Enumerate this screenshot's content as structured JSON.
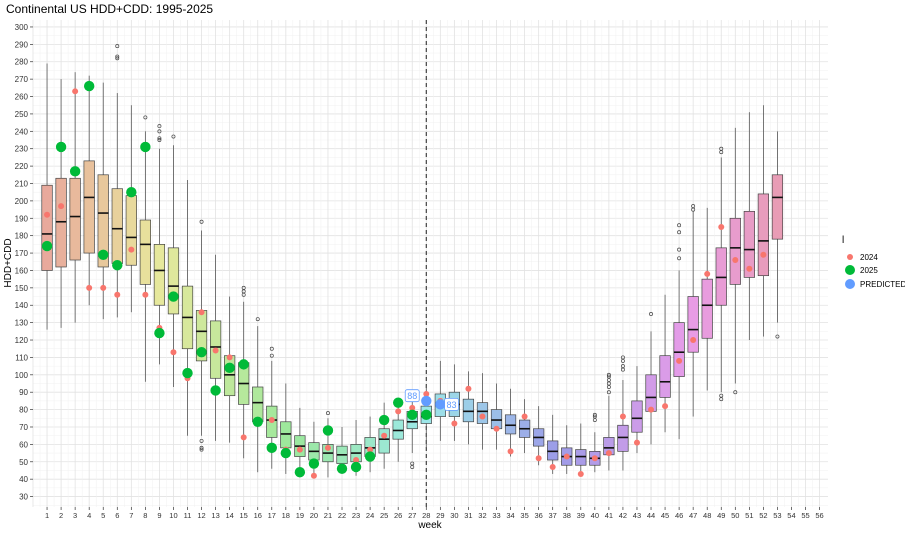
{
  "chart_data": {
    "type": "box",
    "title": "Continental US HDD+CDD: 1995-2025",
    "xlabel": "week",
    "ylabel": "HDD+CDD",
    "x_ticks": [
      "1",
      "2",
      "3",
      "4",
      "5",
      "6",
      "7",
      "8",
      "9",
      "10",
      "11",
      "12",
      "13",
      "14",
      "15",
      "16",
      "17",
      "18",
      "19",
      "20",
      "21",
      "22",
      "23",
      "24",
      "25",
      "26",
      "27",
      "28",
      "29",
      "30",
      "31",
      "32",
      "33",
      "34",
      "35",
      "36",
      "37",
      "38",
      "39",
      "40",
      "41",
      "42",
      "43",
      "44",
      "45",
      "46",
      "47",
      "48",
      "49",
      "50",
      "51",
      "52",
      "53",
      "54",
      "55",
      "56"
    ],
    "xlim": [
      0,
      56.6
    ],
    "ylim": [
      24,
      304
    ],
    "y_ticks": [
      30,
      40,
      50,
      60,
      70,
      80,
      90,
      100,
      110,
      120,
      130,
      140,
      150,
      160,
      170,
      180,
      190,
      200,
      210,
      220,
      230,
      240,
      250,
      260,
      270,
      280,
      290,
      300
    ],
    "grid": true,
    "vline_x": 28,
    "legend": {
      "title": "l",
      "position": "right",
      "items": [
        {
          "label": "2024",
          "color": "#F8766D"
        },
        {
          "label": "2025",
          "color": "#00BA38"
        },
        {
          "label": "PREDICTED",
          "color": "#619CFF"
        }
      ]
    },
    "boxes": [
      {
        "week": 1,
        "min": 126,
        "q1": 160,
        "median": 181,
        "q3": 209,
        "max": 279,
        "outliers": []
      },
      {
        "week": 2,
        "min": 127,
        "q1": 162,
        "median": 188,
        "q3": 213,
        "max": 270,
        "outliers": []
      },
      {
        "week": 3,
        "min": 130,
        "q1": 166,
        "median": 191,
        "q3": 213,
        "max": 274,
        "outliers": []
      },
      {
        "week": 4,
        "min": 140,
        "q1": 170,
        "median": 202,
        "q3": 223,
        "max": 272,
        "outliers": []
      },
      {
        "week": 5,
        "min": 132,
        "q1": 162,
        "median": 193,
        "q3": 215,
        "max": 268,
        "outliers": []
      },
      {
        "week": 6,
        "min": 133,
        "q1": 164,
        "median": 184,
        "q3": 207,
        "max": 262,
        "outliers": [
          282,
          283,
          289
        ]
      },
      {
        "week": 7,
        "min": 136,
        "q1": 163,
        "median": 179,
        "q3": 203,
        "max": 255,
        "outliers": []
      },
      {
        "week": 8,
        "min": 96,
        "q1": 152,
        "median": 175,
        "q3": 189,
        "max": 240,
        "outliers": [
          248
        ]
      },
      {
        "week": 9,
        "min": 106,
        "q1": 140,
        "median": 160,
        "q3": 175,
        "max": 230,
        "outliers": [
          235,
          236,
          240,
          243
        ]
      },
      {
        "week": 10,
        "min": 93,
        "q1": 135,
        "median": 151,
        "q3": 173,
        "max": 232,
        "outliers": [
          237
        ]
      },
      {
        "week": 11,
        "min": 65,
        "q1": 115,
        "median": 133,
        "q3": 151,
        "max": 212,
        "outliers": []
      },
      {
        "week": 12,
        "min": 65,
        "q1": 108,
        "median": 125,
        "q3": 137,
        "max": 183,
        "outliers": [
          188,
          62,
          58,
          57
        ]
      },
      {
        "week": 13,
        "min": 62,
        "q1": 98,
        "median": 116,
        "q3": 131,
        "max": 169,
        "outliers": []
      },
      {
        "week": 14,
        "min": 61,
        "q1": 88,
        "median": 100,
        "q3": 111,
        "max": 145,
        "outliers": []
      },
      {
        "week": 15,
        "min": 52,
        "q1": 83,
        "median": 95,
        "q3": 107,
        "max": 142,
        "outliers": [
          146,
          148,
          150
        ]
      },
      {
        "week": 16,
        "min": 44,
        "q1": 73,
        "median": 84,
        "q3": 93,
        "max": 128,
        "outliers": [
          132
        ]
      },
      {
        "week": 17,
        "min": 46,
        "q1": 64,
        "median": 74,
        "q3": 82,
        "max": 108,
        "outliers": [
          111,
          115
        ]
      },
      {
        "week": 18,
        "min": 43,
        "q1": 58,
        "median": 66,
        "q3": 73,
        "max": 95,
        "outliers": []
      },
      {
        "week": 19,
        "min": 41,
        "q1": 53,
        "median": 59,
        "q3": 65,
        "max": 81,
        "outliers": []
      },
      {
        "week": 20,
        "min": 41,
        "q1": 51,
        "median": 56,
        "q3": 61,
        "max": 73,
        "outliers": []
      },
      {
        "week": 21,
        "min": 41,
        "q1": 50,
        "median": 55,
        "q3": 60,
        "max": 75,
        "outliers": [
          78
        ]
      },
      {
        "week": 22,
        "min": 43,
        "q1": 49,
        "median": 54,
        "q3": 59,
        "max": 70,
        "outliers": []
      },
      {
        "week": 23,
        "min": 42,
        "q1": 50,
        "median": 55,
        "q3": 60,
        "max": 74,
        "outliers": []
      },
      {
        "week": 24,
        "min": 44,
        "q1": 53,
        "median": 58,
        "q3": 64,
        "max": 76,
        "outliers": []
      },
      {
        "week": 25,
        "min": 46,
        "q1": 55,
        "median": 63,
        "q3": 69,
        "max": 84,
        "outliers": []
      },
      {
        "week": 26,
        "min": 50,
        "q1": 63,
        "median": 68,
        "q3": 74,
        "max": 86,
        "outliers": []
      },
      {
        "week": 27,
        "min": 55,
        "q1": 69,
        "median": 73,
        "q3": 79,
        "max": 91,
        "outliers": [
          47,
          49
        ]
      },
      {
        "week": 28,
        "min": 58,
        "q1": 72,
        "median": 76,
        "q3": 82,
        "max": 94,
        "outliers": []
      },
      {
        "week": 29,
        "min": 62,
        "q1": 76,
        "median": 83,
        "q3": 89,
        "max": 108,
        "outliers": []
      },
      {
        "week": 30,
        "min": 62,
        "q1": 76,
        "median": 83,
        "q3": 90,
        "max": 106,
        "outliers": []
      },
      {
        "week": 31,
        "min": 60,
        "q1": 73,
        "median": 79,
        "q3": 86,
        "max": 102,
        "outliers": []
      },
      {
        "week": 32,
        "min": 57,
        "q1": 72,
        "median": 79,
        "q3": 84,
        "max": 101,
        "outliers": []
      },
      {
        "week": 33,
        "min": 57,
        "q1": 69,
        "median": 74,
        "q3": 80,
        "max": 95,
        "outliers": []
      },
      {
        "week": 34,
        "min": 53,
        "q1": 66,
        "median": 71,
        "q3": 77,
        "max": 92,
        "outliers": []
      },
      {
        "week": 35,
        "min": 55,
        "q1": 64,
        "median": 69,
        "q3": 74,
        "max": 86,
        "outliers": []
      },
      {
        "week": 36,
        "min": 48,
        "q1": 59,
        "median": 64,
        "q3": 69,
        "max": 82,
        "outliers": []
      },
      {
        "week": 37,
        "min": 43,
        "q1": 51,
        "median": 56,
        "q3": 62,
        "max": 77,
        "outliers": []
      },
      {
        "week": 38,
        "min": 43,
        "q1": 48,
        "median": 53,
        "q3": 58,
        "max": 71,
        "outliers": []
      },
      {
        "week": 39,
        "min": 42,
        "q1": 48,
        "median": 53,
        "q3": 57,
        "max": 72,
        "outliers": []
      },
      {
        "week": 40,
        "min": 44,
        "q1": 48,
        "median": 52,
        "q3": 56,
        "max": 67,
        "outliers": [
          74,
          76,
          77
        ]
      },
      {
        "week": 41,
        "min": 45,
        "q1": 54,
        "median": 58,
        "q3": 64,
        "max": 88,
        "outliers": [
          90,
          93,
          95,
          97,
          99,
          100
        ]
      },
      {
        "week": 42,
        "min": 45,
        "q1": 56,
        "median": 64,
        "q3": 71,
        "max": 97,
        "outliers": [
          103,
          105,
          108,
          110
        ]
      },
      {
        "week": 43,
        "min": 55,
        "q1": 67,
        "median": 75,
        "q3": 85,
        "max": 105,
        "outliers": []
      },
      {
        "week": 44,
        "min": 60,
        "q1": 79,
        "median": 87,
        "q3": 100,
        "max": 125,
        "outliers": [
          135
        ]
      },
      {
        "week": 45,
        "min": 67,
        "q1": 87,
        "median": 96,
        "q3": 111,
        "max": 146,
        "outliers": []
      },
      {
        "week": 46,
        "min": 63,
        "q1": 99,
        "median": 113,
        "q3": 130,
        "max": 160,
        "outliers": [
          167,
          172,
          182,
          186
        ]
      },
      {
        "week": 47,
        "min": 76,
        "q1": 113,
        "median": 126,
        "q3": 145,
        "max": 194,
        "outliers": [
          195,
          197
        ]
      },
      {
        "week": 48,
        "min": 91,
        "q1": 121,
        "median": 140,
        "q3": 155,
        "max": 196,
        "outliers": []
      },
      {
        "week": 49,
        "min": 90,
        "q1": 140,
        "median": 156,
        "q3": 173,
        "max": 225,
        "outliers": [
          86,
          88,
          228,
          230
        ]
      },
      {
        "week": 50,
        "min": 95,
        "q1": 152,
        "median": 173,
        "q3": 190,
        "max": 242,
        "outliers": [
          90
        ]
      },
      {
        "week": 51,
        "min": 120,
        "q1": 156,
        "median": 172,
        "q3": 194,
        "max": 251,
        "outliers": []
      },
      {
        "week": 52,
        "min": 122,
        "q1": 157,
        "median": 177,
        "q3": 204,
        "max": 255,
        "outliers": []
      },
      {
        "week": 53,
        "min": 130,
        "q1": 178,
        "median": 202,
        "q3": 215,
        "max": 240,
        "outliers": [
          122
        ]
      }
    ],
    "series": [
      {
        "name": "2024",
        "color": "#F8766D",
        "points": [
          {
            "x": 1,
            "y": 192
          },
          {
            "x": 2,
            "y": 197
          },
          {
            "x": 3,
            "y": 263
          },
          {
            "x": 4,
            "y": 150
          },
          {
            "x": 5,
            "y": 150
          },
          {
            "x": 6,
            "y": 146
          },
          {
            "x": 7,
            "y": 172
          },
          {
            "x": 8,
            "y": 146
          },
          {
            "x": 9,
            "y": 127
          },
          {
            "x": 10,
            "y": 113
          },
          {
            "x": 11,
            "y": 98
          },
          {
            "x": 12,
            "y": 136
          },
          {
            "x": 13,
            "y": 114
          },
          {
            "x": 14,
            "y": 110
          },
          {
            "x": 15,
            "y": 64
          },
          {
            "x": 16,
            "y": 72
          },
          {
            "x": 17,
            "y": 74
          },
          {
            "x": 18,
            "y": 57
          },
          {
            "x": 19,
            "y": 57
          },
          {
            "x": 20,
            "y": 42
          },
          {
            "x": 21,
            "y": 58
          },
          {
            "x": 22,
            "y": 46
          },
          {
            "x": 23,
            "y": 51
          },
          {
            "x": 24,
            "y": 57
          },
          {
            "x": 25,
            "y": 65
          },
          {
            "x": 26,
            "y": 79
          },
          {
            "x": 27,
            "y": 81
          },
          {
            "x": 28,
            "y": 89
          },
          {
            "x": 29,
            "y": 85
          },
          {
            "x": 30,
            "y": 72
          },
          {
            "x": 31,
            "y": 92
          },
          {
            "x": 32,
            "y": 76
          },
          {
            "x": 33,
            "y": 69
          },
          {
            "x": 34,
            "y": 56
          },
          {
            "x": 35,
            "y": 76
          },
          {
            "x": 36,
            "y": 52
          },
          {
            "x": 37,
            "y": 47
          },
          {
            "x": 38,
            "y": 53
          },
          {
            "x": 39,
            "y": 43
          },
          {
            "x": 40,
            "y": 52
          },
          {
            "x": 41,
            "y": 55
          },
          {
            "x": 42,
            "y": 76
          },
          {
            "x": 43,
            "y": 61
          },
          {
            "x": 44,
            "y": 80
          },
          {
            "x": 45,
            "y": 82
          },
          {
            "x": 46,
            "y": 108
          },
          {
            "x": 47,
            "y": 120
          },
          {
            "x": 48,
            "y": 158
          },
          {
            "x": 49,
            "y": 185
          },
          {
            "x": 50,
            "y": 166
          },
          {
            "x": 51,
            "y": 161
          },
          {
            "x": 52,
            "y": 169
          }
        ]
      },
      {
        "name": "2025",
        "color": "#00BA38",
        "points": [
          {
            "x": 1,
            "y": 174
          },
          {
            "x": 2,
            "y": 231
          },
          {
            "x": 3,
            "y": 217
          },
          {
            "x": 4,
            "y": 266
          },
          {
            "x": 5,
            "y": 169
          },
          {
            "x": 6,
            "y": 163
          },
          {
            "x": 7,
            "y": 205
          },
          {
            "x": 8,
            "y": 231
          },
          {
            "x": 9,
            "y": 124
          },
          {
            "x": 10,
            "y": 145
          },
          {
            "x": 11,
            "y": 101
          },
          {
            "x": 12,
            "y": 113
          },
          {
            "x": 13,
            "y": 91
          },
          {
            "x": 14,
            "y": 104
          },
          {
            "x": 15,
            "y": 106
          },
          {
            "x": 16,
            "y": 73
          },
          {
            "x": 17,
            "y": 58
          },
          {
            "x": 18,
            "y": 55
          },
          {
            "x": 19,
            "y": 44
          },
          {
            "x": 20,
            "y": 49
          },
          {
            "x": 21,
            "y": 68
          },
          {
            "x": 22,
            "y": 46
          },
          {
            "x": 23,
            "y": 47
          },
          {
            "x": 24,
            "y": 53
          },
          {
            "x": 25,
            "y": 74
          },
          {
            "x": 26,
            "y": 84
          },
          {
            "x": 27,
            "y": 77
          },
          {
            "x": 28,
            "y": 77
          }
        ]
      },
      {
        "name": "PREDICTED",
        "color": "#619CFF",
        "points": [
          {
            "x": 28,
            "y": 85
          },
          {
            "x": 29,
            "y": 83
          }
        ]
      }
    ],
    "annotations": [
      {
        "x": 27,
        "y": 88,
        "text": "88"
      },
      {
        "x": 29.8,
        "y": 83,
        "text": "83"
      }
    ]
  }
}
